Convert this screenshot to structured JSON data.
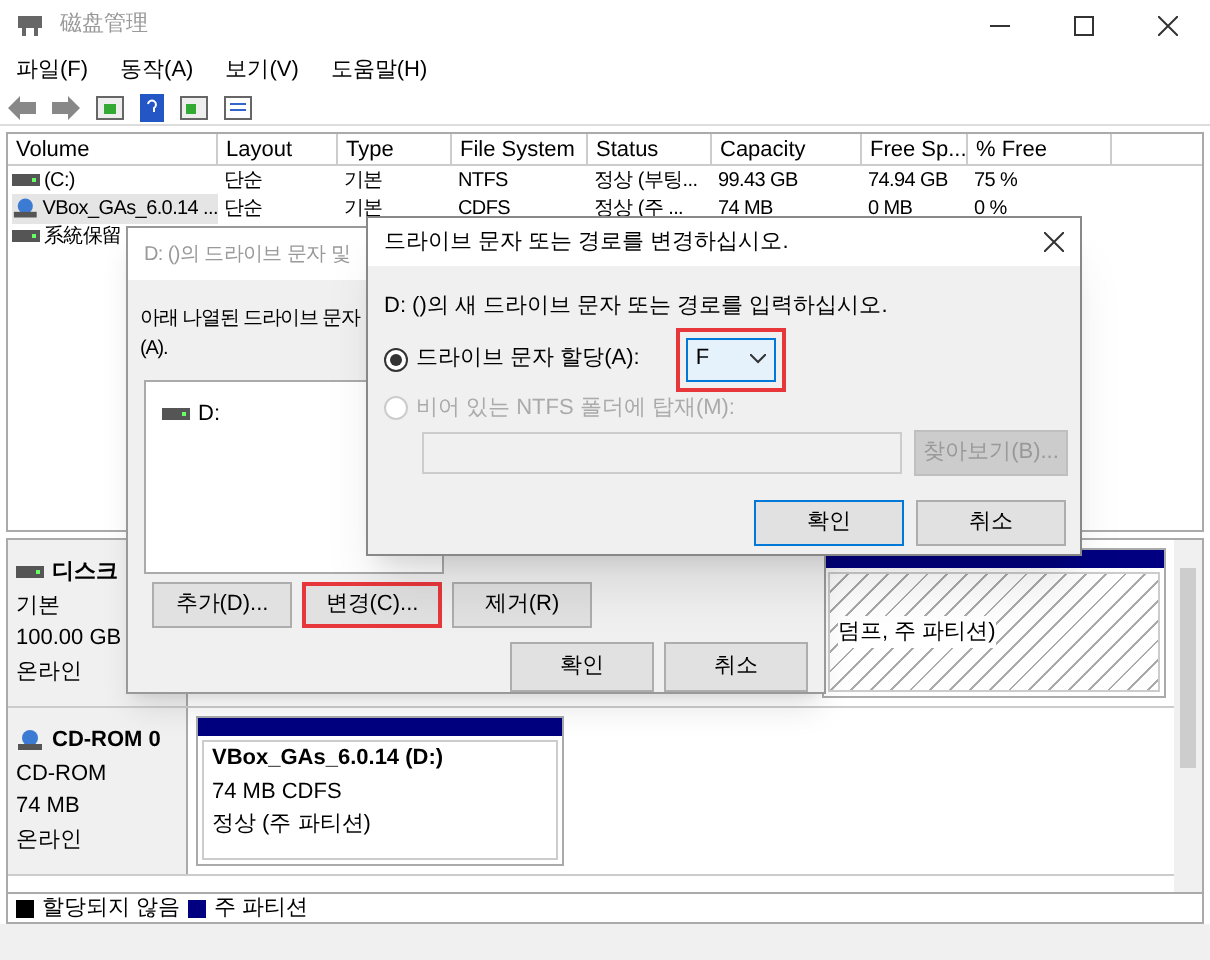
{
  "window": {
    "title": "磁盘管理"
  },
  "menu": [
    "파일(F)",
    "동작(A)",
    "보기(V)",
    "도움말(H)"
  ],
  "table": {
    "columns": [
      "Volume",
      "Layout",
      "Type",
      "File System",
      "Status",
      "Capacity",
      "Free Sp...",
      "% Free"
    ],
    "rows": [
      {
        "kind": "disk",
        "selected": false,
        "cells": [
          "(C:)",
          "단순",
          "기본",
          "NTFS",
          "정상 (부팅...",
          "99.43 GB",
          "74.94 GB",
          "75 %"
        ]
      },
      {
        "kind": "cd",
        "selected": true,
        "cells": [
          "VBox_GAs_6.0.14 ...",
          "단순",
          "기본",
          "CDFS",
          "정상 (주 ...",
          "74 MB",
          "0 MB",
          "0 %"
        ]
      },
      {
        "kind": "disk",
        "selected": false,
        "cells": [
          "系統保留"
        ]
      }
    ]
  },
  "disks": [
    {
      "kind": "disk",
      "name": "디스크",
      "type": "기본",
      "size": "100.00 GB",
      "status": "온라인",
      "partition": {
        "lines": [
          "덤프, 주 파티션)"
        ]
      }
    },
    {
      "kind": "cd",
      "name": "CD-ROM 0",
      "type": "CD-ROM",
      "size": "74 MB",
      "status": "온라인",
      "partition": {
        "title": "VBox_GAs_6.0.14  (D:)",
        "lines": [
          "74 MB CDFS",
          "정상 (주 파티션)"
        ]
      }
    }
  ],
  "legend": [
    {
      "label": "할당되지 않음",
      "color": "#000000"
    },
    {
      "label": "주 파티션",
      "color": "#000080"
    }
  ],
  "back_dialog": {
    "title": "D: ()의 드라이브 문자 및",
    "text": "아래 나열된 드라이브 문자",
    "text_2": "(A).",
    "list": [
      "D:"
    ],
    "buttons": [
      {
        "label": "추가(D)...",
        "highlighted": false
      },
      {
        "label": "변경(C)...",
        "highlighted": true
      },
      {
        "label": "제거(R)",
        "highlighted": false
      }
    ],
    "footer": [
      "확인",
      "취소"
    ]
  },
  "front_dialog": {
    "title": "드라이브 문자 또는 경로를 변경하십시오.",
    "text": "D: ()의 새 드라이브 문자 또는 경로를 입력하십시오.",
    "options": [
      {
        "label": "드라이브 문자 할당(A):",
        "selected": true,
        "disabled": false
      },
      {
        "label": "비어 있는 NTFS 폴더에 탑재(M):",
        "selected": false,
        "disabled": true
      }
    ],
    "letter": {
      "value": "F",
      "highlighted": true
    },
    "browse": {
      "label": "찾아보기(B)...",
      "disabled": true
    },
    "footer": [
      {
        "label": "확인",
        "default": true
      },
      {
        "label": "취소",
        "default": false
      }
    ]
  }
}
